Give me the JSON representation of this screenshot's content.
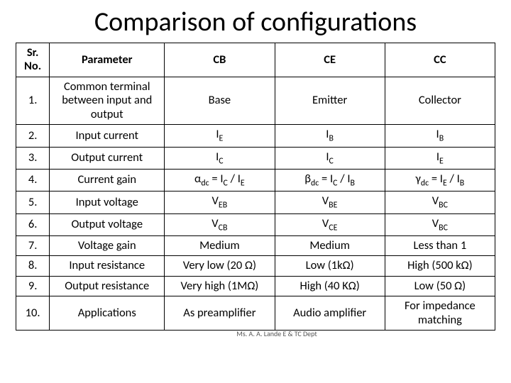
{
  "title": "Comparison of configurations",
  "headers": {
    "sr": "Sr. No.",
    "param": "Parameter",
    "cb": "CB",
    "ce": "CE",
    "cc": "CC"
  },
  "rows": {
    "r1": {
      "no": "1.",
      "param": "Common terminal between input and output",
      "cb": "Base",
      "ce": "Emitter",
      "cc": "Collector"
    },
    "r2": {
      "no": "2.",
      "param": "Input current"
    },
    "r3": {
      "no": "3.",
      "param": "Output current"
    },
    "r4": {
      "no": "4.",
      "param": "Current gain"
    },
    "r5": {
      "no": "5.",
      "param": "Input voltage"
    },
    "r6": {
      "no": "6.",
      "param": "Output voltage"
    },
    "r7": {
      "no": "7.",
      "param": "Voltage gain",
      "cb": "Medium",
      "ce": "Medium",
      "cc": "Less than 1"
    },
    "r8": {
      "no": "8.",
      "param": "Input resistance",
      "cb": "Very low (20 Ω)",
      "ce": "Low (1kΩ)",
      "cc": "High (500 kΩ)"
    },
    "r9": {
      "no": "9.",
      "param": "Output resistance",
      "cb": "Very high (1MΩ)",
      "ce": "High (40 KΩ)",
      "cc": "Low (50 Ω)"
    },
    "r10": {
      "no": "10.",
      "param": "Applications",
      "cb": "As preamplifier",
      "ce": "Audio amplifier",
      "cc": "For impedance matching"
    }
  },
  "sym": {
    "I": "I",
    "V": "V",
    "E": "E",
    "B": "B",
    "C": "C",
    "EB": "EB",
    "BE": "BE",
    "BC": "BC",
    "CB": "CB",
    "CE": "CE",
    "alpha": "α",
    "beta": "β",
    "gamma": "γ",
    "dc": "dc",
    "eq": " = ",
    "slash": " / "
  },
  "footer": "Ms. A. A. Lande E & TC Dept"
}
